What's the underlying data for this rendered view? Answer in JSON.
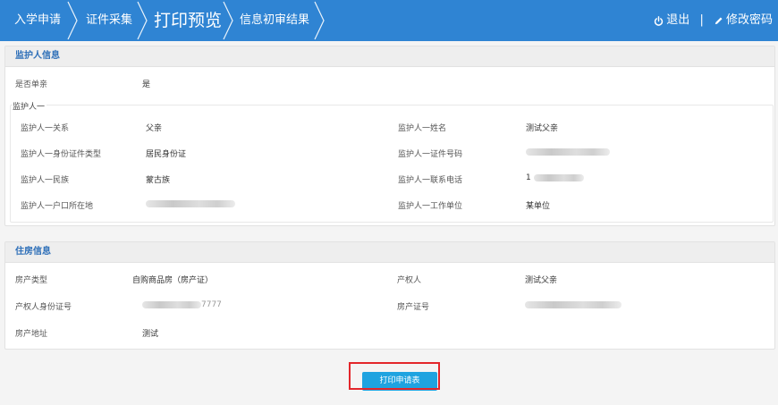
{
  "nav": {
    "steps": [
      {
        "label": "入学申请",
        "active": false
      },
      {
        "label": "证件采集",
        "active": false
      },
      {
        "label": "打印预览",
        "active": true
      },
      {
        "label": "信息初审结果",
        "active": false
      }
    ],
    "logout_label": "退出",
    "separator": "|",
    "change_password_label": "修改密码",
    "bar_color": "#2f84d3"
  },
  "guardian": {
    "title": "监护人信息",
    "single_parent_label": "是否单亲",
    "single_parent_value": "是",
    "group_title": "监护人一",
    "relation_label": "监护人一关系",
    "relation_value": "父亲",
    "name_label": "监护人一姓名",
    "name_value": "测试父亲",
    "id_type_label": "监护人一身份证件类型",
    "id_type_value": "居民身份证",
    "id_number_label": "监护人一证件号码",
    "ethnicity_label": "监护人一民族",
    "ethnicity_value": "蒙古族",
    "phone_label": "监护人一联系电话",
    "phone_value_visible": "1",
    "hukou_label": "监护人一户口所在地",
    "employer_label": "监护人一工作单位",
    "employer_value": "某单位"
  },
  "housing": {
    "title": "住房信息",
    "property_type_label": "房产类型",
    "property_type_value": "自购商品房（房产证）",
    "owner_label": "产权人",
    "owner_value": "测试父亲",
    "owner_id_label": "产权人身份证号",
    "owner_id_visible_suffix": "7777",
    "cert_label": "房产证号",
    "address_label": "房产地址",
    "address_value": "测试"
  },
  "actions": {
    "print_label": "打印申请表",
    "print_color": "#1fa3e0",
    "highlight_color": "#e3262b"
  }
}
